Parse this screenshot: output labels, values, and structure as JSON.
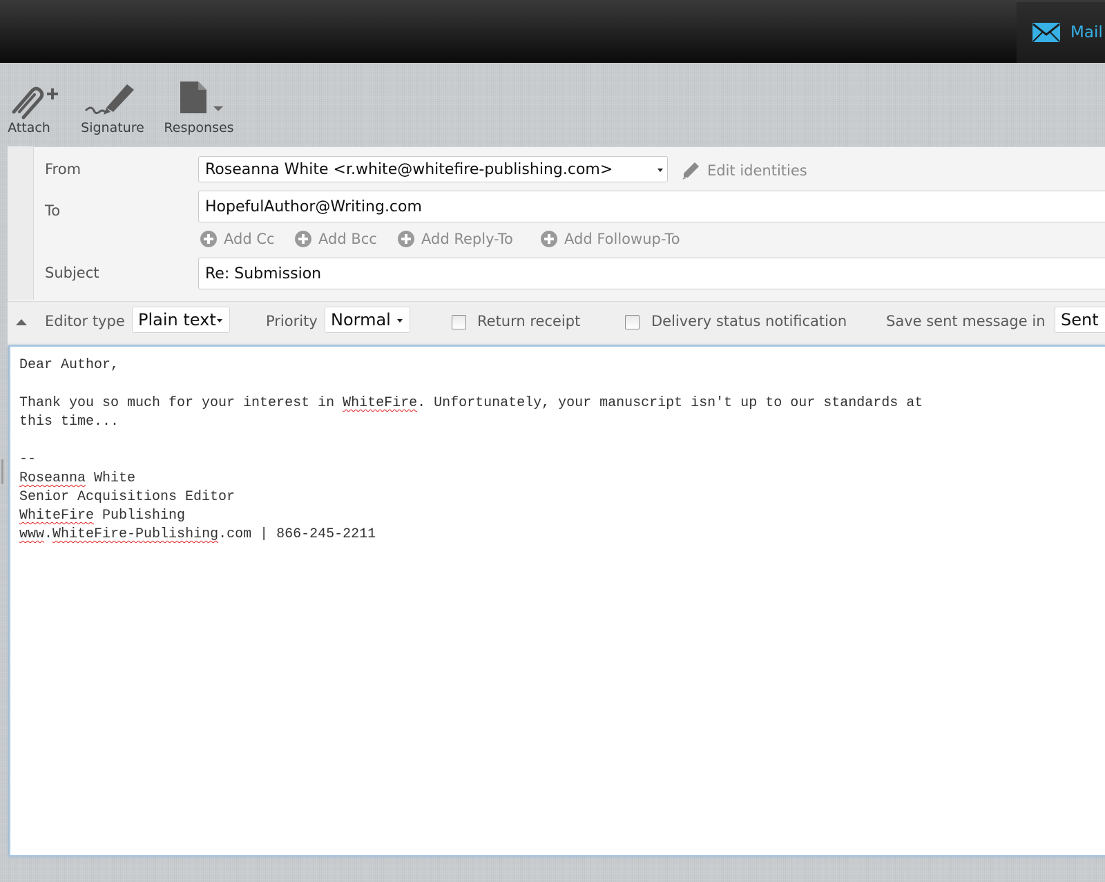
{
  "topbar": {
    "mail_label": "Mail"
  },
  "toolbar": {
    "attach": "Attach",
    "signature": "Signature",
    "responses": "Responses"
  },
  "header": {
    "from_label": "From",
    "from_value": "Roseanna White <r.white@whitefire-publishing.com>",
    "edit_identities": "Edit identities",
    "to_label": "To",
    "to_value": "HopefulAuthor@Writing.com",
    "add_cc": "Add Cc",
    "add_bcc": "Add Bcc",
    "add_reply_to": "Add Reply-To",
    "add_followup_to": "Add Followup-To",
    "subject_label": "Subject",
    "subject_value": "Re: Submission"
  },
  "options": {
    "editor_type_label": "Editor type",
    "editor_type_value": "Plain text",
    "priority_label": "Priority",
    "priority_value": "Normal",
    "return_receipt": "Return receipt",
    "return_receipt_checked": false,
    "delivery_status": "Delivery status notification",
    "delivery_status_checked": false,
    "save_sent_label": "Save sent message in",
    "save_sent_value": "Sent"
  },
  "body": {
    "greeting": "Dear Author,",
    "line1_a": "Thank you so much for your interest in ",
    "line1_b": "WhiteFire",
    "line1_c": ". Unfortunately, your manuscript isn't up to our standards at",
    "line2": "this time...",
    "sig_sep": "--",
    "sig_name_a": "Roseanna",
    "sig_name_b": " White",
    "sig_title": "Senior Acquisitions Editor",
    "sig_company_a": "WhiteFire",
    "sig_company_b": " Publishing",
    "sig_web_a": "www",
    "sig_web_b": ".",
    "sig_web_c": "WhiteFire-Publishing",
    "sig_web_d": ".com | 866-245-2211"
  },
  "colors": {
    "accent": "#37b0e6",
    "spellcheck": "#e02020"
  },
  "icons": [
    "mail-icon",
    "attach-icon",
    "signature-icon",
    "responses-icon",
    "pencil-icon",
    "plus-circle-icon",
    "collapse-arrow-icon"
  ]
}
